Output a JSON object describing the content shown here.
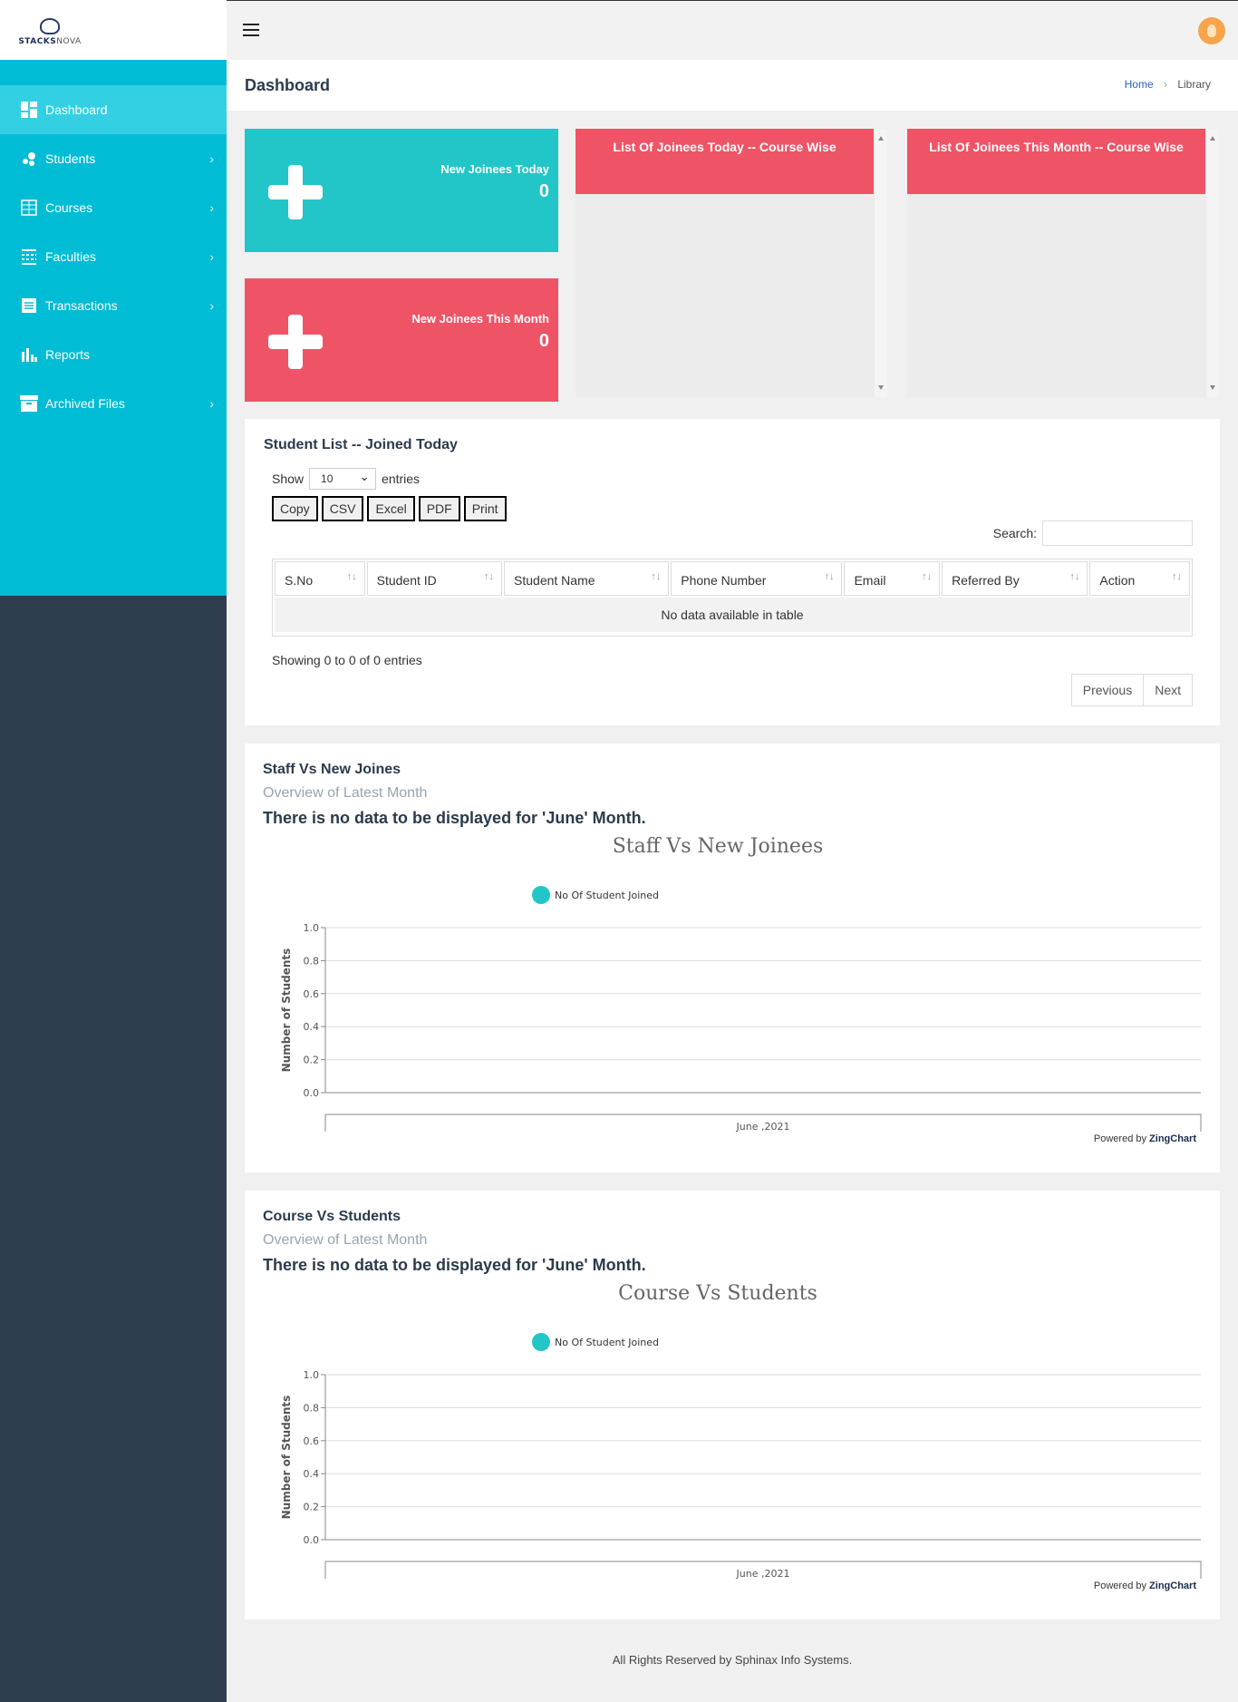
{
  "brand": {
    "name_bold": "STACKS",
    "name_light": "NOVA"
  },
  "sidebar": {
    "items": [
      {
        "label": "Dashboard",
        "icon": "dashboard-icon",
        "active": true
      },
      {
        "label": "Students",
        "icon": "students-icon",
        "chevron": true
      },
      {
        "label": "Courses",
        "icon": "courses-icon",
        "chevron": true
      },
      {
        "label": "Faculties",
        "icon": "faculties-icon",
        "chevron": true
      },
      {
        "label": "Transactions",
        "icon": "transactions-icon",
        "chevron": true
      },
      {
        "label": "Reports",
        "icon": "reports-icon"
      },
      {
        "label": "Archived Files",
        "icon": "archive-icon",
        "chevron": true
      }
    ]
  },
  "header": {
    "title": "Dashboard",
    "breadcrumb": {
      "home": "Home",
      "current": "Library"
    }
  },
  "stats": {
    "today": {
      "label": "New Joinees Today",
      "value": "0",
      "color": "#22c6c8"
    },
    "month": {
      "label": "New Joinees This Month",
      "value": "0",
      "color": "#ef5466"
    }
  },
  "lists": {
    "today_title": "List Of Joinees Today -- Course Wise",
    "month_title": "List Of Joinees This Month -- Course Wise"
  },
  "student_table": {
    "title": "Student List -- Joined Today",
    "show_label": "Show",
    "entries_value": "10",
    "entries_label": "entries",
    "buttons": [
      "Copy",
      "CSV",
      "Excel",
      "PDF",
      "Print"
    ],
    "search_label": "Search:",
    "columns": [
      "S.No",
      "Student ID",
      "Student Name",
      "Phone Number",
      "Email",
      "Referred By",
      "Action"
    ],
    "empty_text": "No data available in table",
    "info": "Showing 0 to 0 of 0 entries",
    "prev": "Previous",
    "next": "Next"
  },
  "charts_panels": [
    {
      "heading": "Staff Vs New Joines",
      "subheading": "Overview of Latest Month",
      "message": "There is no data to be displayed for 'June' Month.",
      "powered_by": "Powered by",
      "powered_brand": "ZingChart"
    },
    {
      "heading": "Course Vs Students",
      "subheading": "Overview of Latest Month",
      "message": "There is no data to be displayed for 'June' Month.",
      "powered_by": "Powered by",
      "powered_brand": "ZingChart"
    }
  ],
  "chart_data": [
    {
      "type": "bar",
      "title": "Staff Vs New Joinees",
      "categories": [
        "June ,2021"
      ],
      "series": [
        {
          "name": "No Of Student Joined",
          "values": []
        }
      ],
      "ylabel": "Number of Students",
      "ylim": [
        0,
        1.0
      ],
      "yticks": [
        "0.0",
        "0.2",
        "0.4",
        "0.6",
        "0.8",
        "1.0"
      ],
      "legend": "top",
      "grid": true,
      "series_color": "#22c6c8"
    },
    {
      "type": "bar",
      "title": "Course Vs Students",
      "categories": [
        "June ,2021"
      ],
      "series": [
        {
          "name": "No Of Student Joined",
          "values": []
        }
      ],
      "ylabel": "Number of Students",
      "ylim": [
        0,
        1.0
      ],
      "yticks": [
        "0.0",
        "0.2",
        "0.4",
        "0.6",
        "0.8",
        "1.0"
      ],
      "legend": "top",
      "grid": true,
      "series_color": "#22c6c8"
    }
  ],
  "footer": "All Rights Reserved by Sphinax Info Systems."
}
